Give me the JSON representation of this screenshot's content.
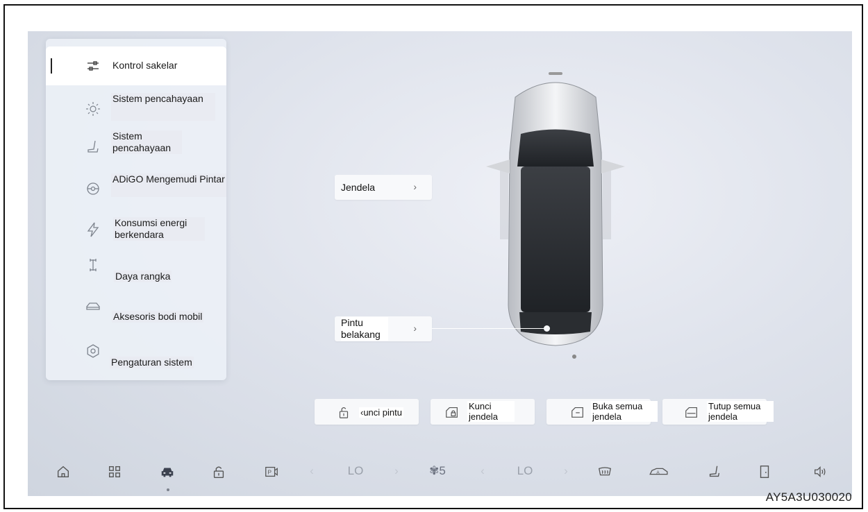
{
  "menu": {
    "items": [
      {
        "label": "Kontrol sakelar",
        "icon": "switch-control-icon",
        "active": true
      },
      {
        "label": "Sistem pencahayaan",
        "icon": "light-icon"
      },
      {
        "label": "Sistem pencahayaan",
        "icon": "seat-icon"
      },
      {
        "label": "ADiGO Mengemudi Pintar",
        "icon": "steering-wheel-icon"
      },
      {
        "label": "Konsumsi energi berkendara",
        "icon": "lightning-icon"
      },
      {
        "label": "Daya rangka",
        "icon": "chassis-icon"
      },
      {
        "label": "Aksesoris bodi mobil",
        "icon": "car-body-icon"
      },
      {
        "label": "Pengaturan sistem",
        "icon": "gear-icon"
      }
    ]
  },
  "car_controls": {
    "window_button": "Jendela",
    "tailgate_button": "Pintu belakang"
  },
  "actions": [
    {
      "label": "Kunci pintu",
      "shown": "‹unci pintu",
      "icon": "lock-icon"
    },
    {
      "label": "Kunci jendela",
      "icon": "window-lock-icon"
    },
    {
      "label": "Buka semua jendela",
      "icon": "window-open-icon"
    },
    {
      "label": "Tutup semua jendela",
      "icon": "window-close-icon"
    }
  ],
  "bottom_bar": {
    "left_temp": "LO",
    "fan_speed": "5",
    "right_temp": "LO"
  },
  "caption": "AY5A3U030020"
}
